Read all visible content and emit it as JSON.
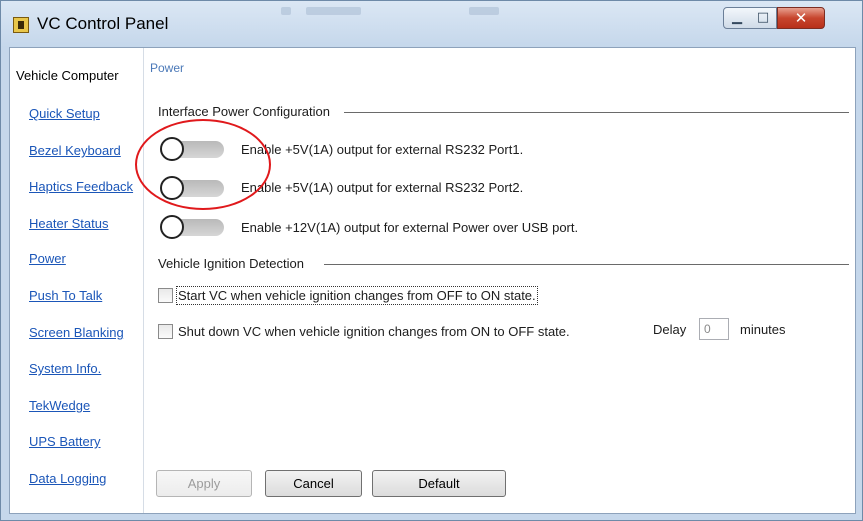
{
  "window": {
    "title": "VC Control Panel"
  },
  "sidebar": {
    "header": "Vehicle Computer",
    "items": [
      {
        "label": "Quick Setup"
      },
      {
        "label": "Bezel Keyboard"
      },
      {
        "label": "Haptics Feedback"
      },
      {
        "label": "Heater Status"
      },
      {
        "label": "Power"
      },
      {
        "label": "Push To Talk"
      },
      {
        "label": "Screen Blanking"
      },
      {
        "label": "System Info."
      },
      {
        "label": "TekWedge"
      },
      {
        "label": "UPS Battery"
      },
      {
        "label": "Data Logging"
      }
    ]
  },
  "main": {
    "breadcrumb": "Power",
    "power_group": {
      "title": "Interface Power Configuration",
      "options": [
        {
          "label": "Enable +5V(1A) output for external RS232 Port1.",
          "state": "off"
        },
        {
          "label": "Enable +5V(1A) output for external RS232 Port2.",
          "state": "off"
        },
        {
          "label": "Enable +12V(1A) output for external Power over USB port.",
          "state": "off"
        }
      ]
    },
    "ignition_group": {
      "title": "Vehicle Ignition Detection",
      "start_label": "Start VC when vehicle ignition changes from OFF to ON state.",
      "start_checked": false,
      "shutdown_label": "Shut down VC when vehicle ignition changes from ON to OFF state.",
      "shutdown_checked": false,
      "delay_label": "Delay",
      "delay_value": "0",
      "minutes_label": "minutes"
    },
    "buttons": {
      "apply": "Apply",
      "cancel": "Cancel",
      "default": "Default"
    }
  },
  "colors": {
    "link": "#1b56b8",
    "annotation_circle": "#e0191c",
    "accent": "#4b79b8"
  }
}
